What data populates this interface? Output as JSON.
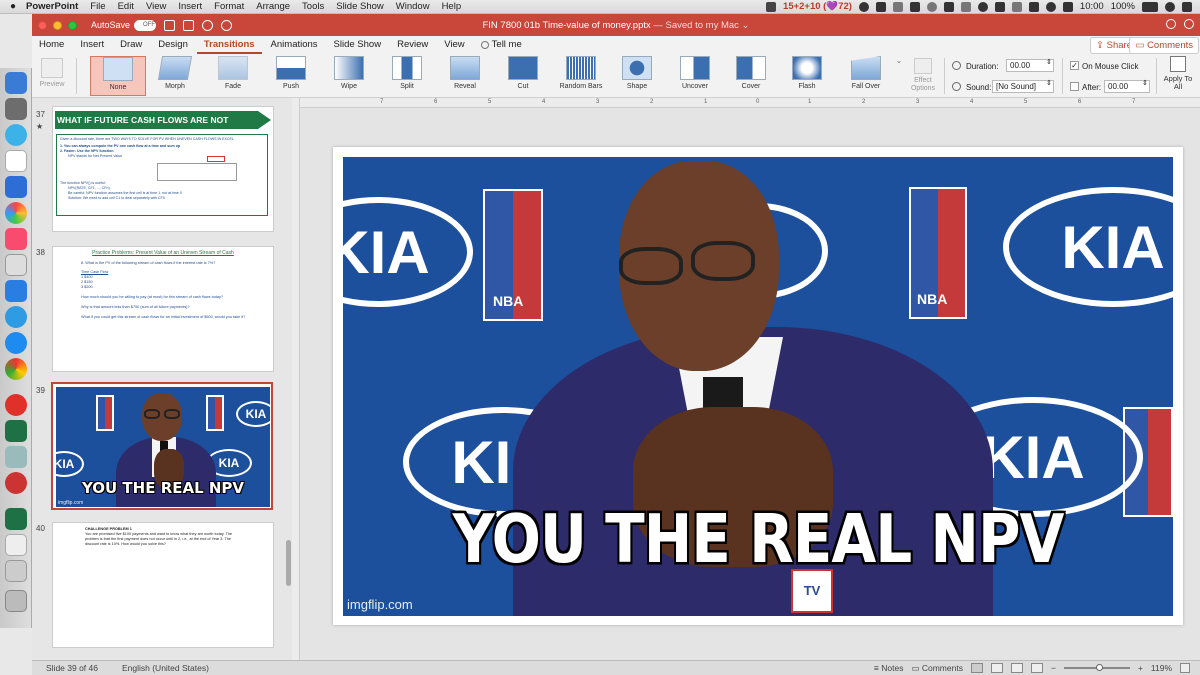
{
  "menubar": {
    "app": "PowerPoint",
    "items": [
      "File",
      "Edit",
      "View",
      "Insert",
      "Format",
      "Arrange",
      "Tools",
      "Slide Show",
      "Window",
      "Help"
    ],
    "status_text": "15+2+10 (💜72)",
    "battery": "100%",
    "time": "10:00"
  },
  "titlebar": {
    "autosave_label": "AutoSave",
    "autosave_state": "OFF",
    "filename": "FIN 7800 01b Time-value of money.pptx",
    "saved_status": "— Saved to my Mac ⌄"
  },
  "tabs": [
    "Home",
    "Insert",
    "Draw",
    "Design",
    "Transitions",
    "Animations",
    "Slide Show",
    "Review",
    "View"
  ],
  "active_tab": "Transitions",
  "tell_me": "Tell me",
  "share_label": "Share",
  "comments_label": "Comments",
  "ribbon": {
    "preview": "Preview",
    "transitions": [
      "None",
      "Morph",
      "Fade",
      "Push",
      "Wipe",
      "Split",
      "Reveal",
      "Cut",
      "Random Bars",
      "Shape",
      "Uncover",
      "Cover",
      "Flash",
      "Fall Over"
    ],
    "selected": "None",
    "effect_options": "Effect Options",
    "duration_label": "Duration:",
    "duration_value": "00.00",
    "sound_label": "Sound:",
    "sound_value": "[No Sound]",
    "on_mouse_click": "On Mouse Click",
    "after_label": "After:",
    "after_value": "00.00",
    "apply_to_all": "Apply To All"
  },
  "ruler_ticks": [
    "7",
    "6",
    "5",
    "4",
    "3",
    "2",
    "1",
    "0",
    "1",
    "2",
    "3",
    "4",
    "5",
    "6",
    "7"
  ],
  "slides": {
    "s37": {
      "num": "37",
      "title": "WHAT IF FUTURE CASH FLOWS ARE NOT CONSTANT?",
      "lines": [
        "Given a discount rate, there are TWO WAYS TO SOLVE FOR PV WHEN UNEVEN CASH FLOWS IN EXCEL",
        "1.  You can always compute the PV one cash flow at a time and sum up",
        "2.  Faster: Use the NPV function",
        "NPV stands for Net Present Value",
        "The function NPV() is useful:",
        "NPV(RATE, CF1, ..., CFn)",
        "Be careful: NPV function assumes the first cell is at time 1, not at time 0",
        "Solution: We need to add cell C1 to deal separately with CF0"
      ]
    },
    "s38": {
      "num": "38",
      "title": "Practice Problems: Present Value of an Uneven Stream of Cash",
      "lines": [
        "8.   What is the PV of the following stream of cash flows if the interest rate is 7%?",
        "Time      Cash Flow",
        "1            $400",
        "2            $150",
        "3            $200",
        "How much should you be willing to pay (at most) for this stream of cash flows today?",
        "Why is that amount less than $750 (sum of all future payments)?",
        "What if you could get this stream of cash flows for an initial investment of $500, would you take it?"
      ]
    },
    "s39": {
      "num": "39"
    },
    "s40": {
      "num": "40",
      "title": "CHALLENGE PROBLEM 1",
      "body": "You are promised five $100 payments and want to know what they are worth today. The problem is that the first payment does not occur until in 2, i.e., at the end of Year 3. The discount rate is 10%. How would you solve this?"
    }
  },
  "meme": {
    "caption": "YOU THE REAL NPV",
    "watermark": "imgflip.com",
    "kia": "KIA",
    "nba": "NBA",
    "tv": "TV"
  },
  "status": {
    "slide_info": "Slide 39 of 46",
    "language": "English (United States)",
    "notes": "Notes",
    "comments": "Comments",
    "zoom": "119%"
  },
  "colors": {
    "title_bar": "#c8463a",
    "accent": "#b7472a",
    "slide_green": "#1f7a45",
    "meme_blue": "#1c4f9c"
  }
}
